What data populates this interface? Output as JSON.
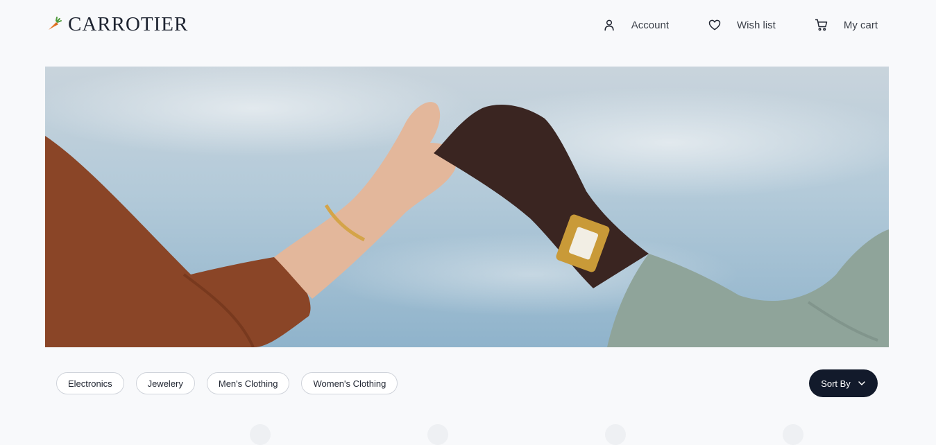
{
  "brand": {
    "name": "CARROTIER",
    "logo_icon": "carrot-icon"
  },
  "nav": {
    "account": {
      "label": "Account",
      "icon": "user-icon"
    },
    "wishlist": {
      "label": "Wish list",
      "icon": "heart-icon"
    },
    "cart": {
      "label": "My cart",
      "icon": "cart-icon"
    }
  },
  "hero": {
    "image": "hero-banner-image"
  },
  "categories": [
    {
      "label": "Electronics"
    },
    {
      "label": "Jewelery"
    },
    {
      "label": "Men's Clothing"
    },
    {
      "label": "Women's Clothing"
    }
  ],
  "sort": {
    "label": "Sort By",
    "icon": "chevron-down-icon"
  },
  "colors": {
    "accent": "#121a2b",
    "background": "#f8f9fb",
    "chip_border": "#cfd3da"
  }
}
